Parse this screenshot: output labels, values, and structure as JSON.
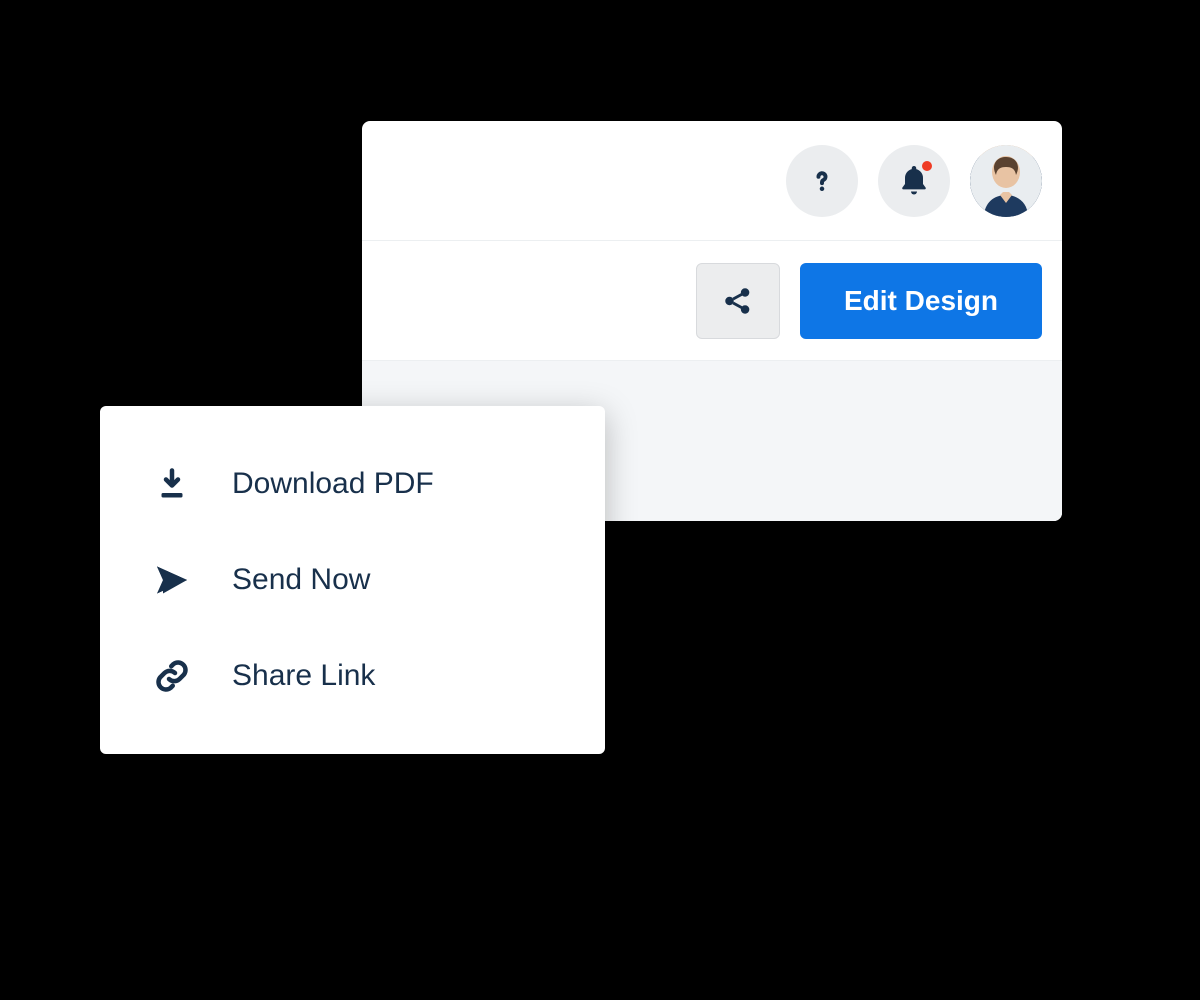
{
  "header": {
    "help_icon": "help",
    "notifications_icon": "bell",
    "has_notification_badge": true
  },
  "toolbar": {
    "share_icon": "share",
    "edit_button_label": "Edit Design"
  },
  "share_menu": {
    "items": [
      {
        "icon": "download",
        "label": "Download PDF"
      },
      {
        "icon": "send",
        "label": "Send Now"
      },
      {
        "icon": "link",
        "label": "Share Link"
      }
    ]
  },
  "colors": {
    "primary": "#0e76e6",
    "dark": "#18304b",
    "badge": "#ef3b24"
  }
}
